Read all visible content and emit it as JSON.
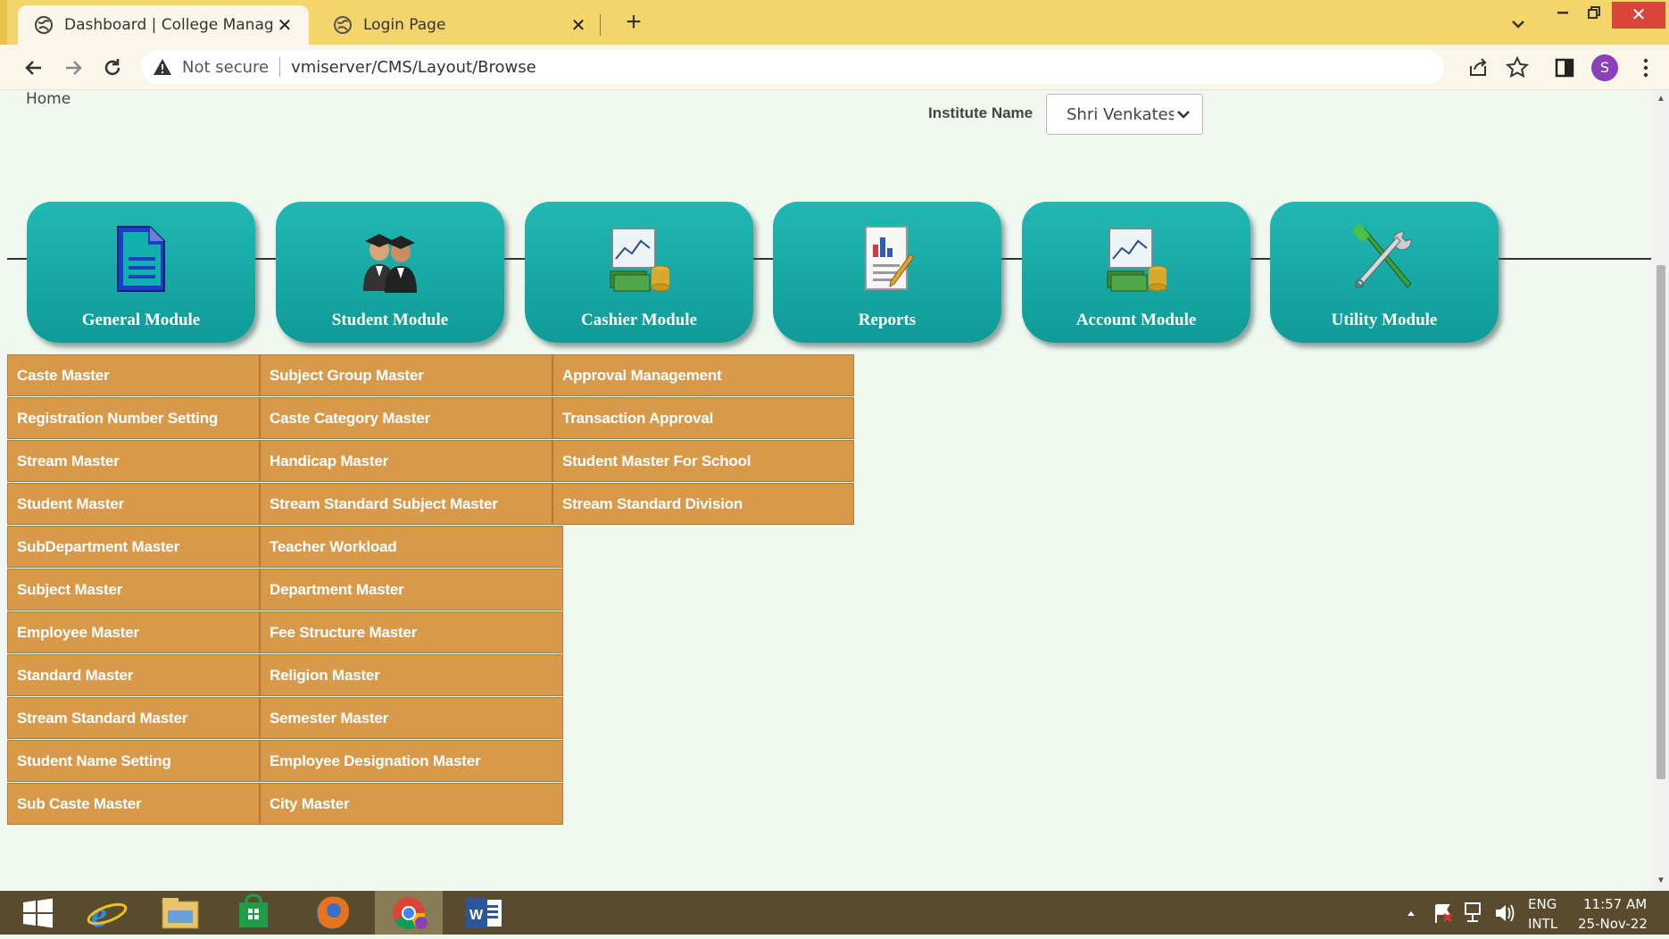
{
  "browser": {
    "tabs": [
      {
        "title": "Dashboard | College Management",
        "active": true
      },
      {
        "title": "Login Page",
        "active": false
      }
    ],
    "close_glyph": "✕",
    "new_tab_glyph": "+",
    "security_label": "Not secure",
    "url": "vmiserver/CMS/Layout/Browse",
    "profile_initial": "S"
  },
  "page": {
    "home_link": "Home",
    "institute_label": "Institute Name",
    "institute_value": "Shri Venkatesh"
  },
  "modules": [
    {
      "label": "General Module",
      "icon": "document-icon"
    },
    {
      "label": "Student Module",
      "icon": "students-icon"
    },
    {
      "label": "Cashier Module",
      "icon": "cash-chart-icon"
    },
    {
      "label": "Reports",
      "icon": "report-icon"
    },
    {
      "label": "Account Module",
      "icon": "cash-chart-icon"
    },
    {
      "label": "Utility Module",
      "icon": "tools-icon"
    }
  ],
  "menu": {
    "col1": [
      "Caste Master",
      "Registration Number Setting",
      "Stream Master",
      "Student Master",
      "SubDepartment Master",
      "Subject Master",
      "Employee Master",
      "Standard Master",
      "Stream Standard Master",
      "Student Name Setting",
      "Sub Caste Master"
    ],
    "col2": [
      "Subject Group Master",
      "Caste Category Master",
      "Handicap Master",
      "Stream Standard Subject Master",
      "Teacher Workload",
      "Department Master",
      "Fee Structure Master",
      "Religion Master",
      "Semester Master",
      "Employee Designation Master",
      "City Master"
    ],
    "col3": [
      "Approval Management",
      "Transaction Approval",
      "Student Master For School",
      "Stream Standard Division"
    ]
  },
  "taskbar": {
    "apps": [
      "windows-start-icon",
      "internet-explorer-icon",
      "file-explorer-icon",
      "store-icon",
      "firefox-icon",
      "chrome-icon",
      "word-icon"
    ],
    "lang_top": "ENG",
    "lang_bottom": "INTL",
    "time": "11:57 AM",
    "date": "25-Nov-22"
  },
  "colors": {
    "tile": "#14a9a5",
    "menu": "#d89a4a",
    "tabbar": "#f3d56b",
    "taskbar": "#584b2e"
  }
}
